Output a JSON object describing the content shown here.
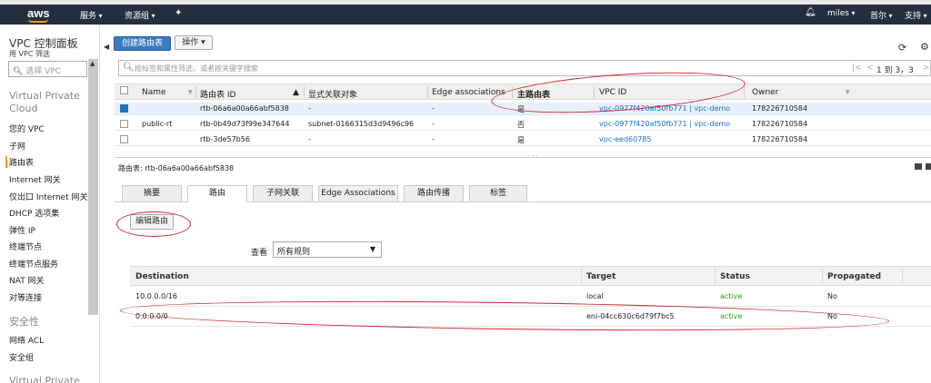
{
  "nav": {
    "logo": "aws",
    "services": "服务",
    "resource_groups": "资源组",
    "user": "miles",
    "region": "首尔",
    "support": "支持"
  },
  "sidebar": {
    "title": "VPC 控制面板",
    "filter_label": "用 VPC 筛选",
    "filter_placeholder": "选择 VPC",
    "section1": "Virtual Private Cloud",
    "items": [
      {
        "label": "您的 VPC"
      },
      {
        "label": "子网"
      },
      {
        "label": "路由表"
      },
      {
        "label": "Internet 网关"
      },
      {
        "label": "仅出口 Internet 网关"
      },
      {
        "label": "DHCP 选项集"
      },
      {
        "label": "弹性 IP"
      },
      {
        "label": "终端节点"
      },
      {
        "label": "终端节点服务"
      },
      {
        "label": "NAT 网关"
      },
      {
        "label": "对等连接"
      }
    ],
    "section2": "安全性",
    "security_items": [
      {
        "label": "网络 ACL"
      },
      {
        "label": "安全组"
      }
    ],
    "section3": "Virtual Private"
  },
  "toolbar": {
    "create_label": "创建路由表",
    "actions_label": "操作"
  },
  "search": {
    "placeholder": "按标签和属性筛选，或者按关键字搜索"
  },
  "pager": {
    "text": "1 到 3，3"
  },
  "table": {
    "columns": [
      "Name",
      "路由表 ID",
      "显式关联对象",
      "Edge associations",
      "主路由表",
      "VPC ID",
      "Owner"
    ],
    "rows": [
      {
        "name": "",
        "id": "rtb-06a6a00a66abf5838",
        "assoc": "-",
        "edge": "-",
        "main": "是",
        "vpc": "vpc-0977f420af50fb771 | vpc-demo",
        "owner": "178226710584"
      },
      {
        "name": "public-rt",
        "id": "rtb-0b49d73f99e347644",
        "assoc": "subnet-0166315d3d9496c96",
        "edge": "-",
        "main": "否",
        "vpc": "vpc-0977f420af50fb771 | vpc-demo",
        "owner": "178226710584"
      },
      {
        "name": "",
        "id": "rtb-3de57b56",
        "assoc": "-",
        "edge": "-",
        "main": "是",
        "vpc": "vpc-eed60785",
        "owner": "178226710584"
      }
    ]
  },
  "detail": {
    "title": "路由表: rtb-06a6a00a66abf5838",
    "tabs": [
      "摘要",
      "路由",
      "子网关联",
      "Edge Associations",
      "路由传播",
      "标签"
    ],
    "edit_routes": "编辑路由",
    "view_label": "查看",
    "view_value": "所有规则"
  },
  "routes": {
    "columns": [
      "Destination",
      "Target",
      "Status",
      "Propagated"
    ],
    "rows": [
      {
        "destination": "10.0.0.0/16",
        "target": "local",
        "status": "active",
        "propagated": "No"
      },
      {
        "destination": "0.0.0.0/0",
        "target": "eni-04cc630c6d79f7bc5",
        "status": "active",
        "propagated": "No"
      }
    ]
  },
  "colors": {
    "nav_bg": "#232f3e",
    "primary": "#3b79c2",
    "link": "#1d6ec6",
    "active_status": "#2a9d2a",
    "annotation": "#d0282b"
  }
}
